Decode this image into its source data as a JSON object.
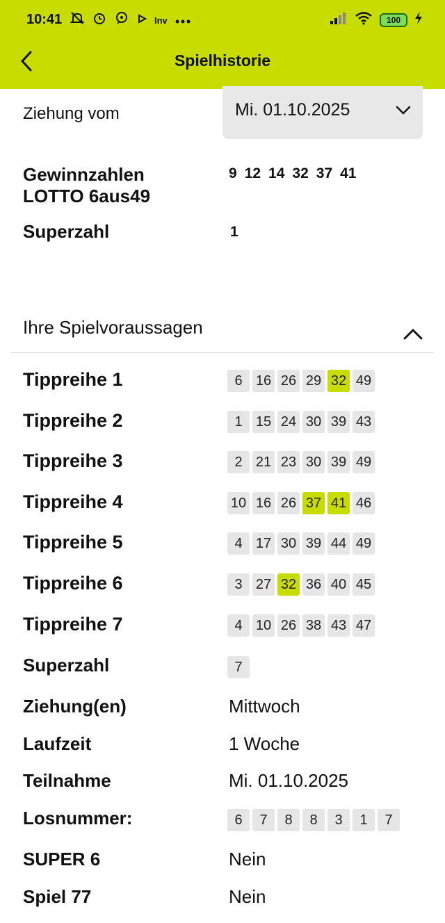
{
  "status_bar": {
    "time": "10:41",
    "icons": [
      "muted-notification-icon",
      "alarm-icon",
      "chat-bubble-icon",
      "play-icon",
      "inv-badge",
      "more-dots"
    ],
    "inv_label": "Inv",
    "battery": "100"
  },
  "header": {
    "title": "Spielhistorie",
    "accent_color": "#c8dc00"
  },
  "draw": {
    "label": "Ziehung vom",
    "selected": "Mi. 01.10.2025",
    "winning_label_line1": "Gewinnzahlen",
    "winning_label_line2": "LOTTO 6aus49",
    "winning_numbers": [
      "9",
      "12",
      "14",
      "32",
      "37",
      "41"
    ],
    "superzahl_label": "Superzahl",
    "superzahl_value": "1"
  },
  "predictions": {
    "title": "Ihre Spielvoraussagen",
    "rows": [
      {
        "label": "Tippreihe 1",
        "numbers": [
          "6",
          "16",
          "26",
          "29",
          "32",
          "49"
        ],
        "hits": [
          4
        ]
      },
      {
        "label": "Tippreihe 2",
        "numbers": [
          "1",
          "15",
          "24",
          "30",
          "39",
          "43"
        ],
        "hits": []
      },
      {
        "label": "Tippreihe 3",
        "numbers": [
          "2",
          "21",
          "23",
          "30",
          "39",
          "49"
        ],
        "hits": []
      },
      {
        "label": "Tippreihe 4",
        "numbers": [
          "10",
          "16",
          "26",
          "37",
          "41",
          "46"
        ],
        "hits": [
          3,
          4
        ]
      },
      {
        "label": "Tippreihe 5",
        "numbers": [
          "4",
          "17",
          "30",
          "39",
          "44",
          "49"
        ],
        "hits": []
      },
      {
        "label": "Tippreihe 6",
        "numbers": [
          "3",
          "27",
          "32",
          "36",
          "40",
          "45"
        ],
        "hits": [
          2
        ]
      },
      {
        "label": "Tippreihe 7",
        "numbers": [
          "4",
          "10",
          "26",
          "38",
          "43",
          "47"
        ],
        "hits": []
      }
    ],
    "superzahl_label": "Superzahl",
    "superzahl_value": "7"
  },
  "details": {
    "ziehungen_label": "Ziehung(en)",
    "ziehungen_value": "Mittwoch",
    "laufzeit_label": "Laufzeit",
    "laufzeit_value": "1 Woche",
    "teilnahme_label": "Teilnahme",
    "teilnahme_value": "Mi. 01.10.2025",
    "losnummer_label": "Losnummer:",
    "losnummer_digits": [
      "6",
      "7",
      "8",
      "8",
      "3",
      "1",
      "7"
    ],
    "super6_label": "SUPER 6",
    "super6_value": "Nein",
    "spiel77_label": "Spiel 77",
    "spiel77_value": "Nein"
  }
}
